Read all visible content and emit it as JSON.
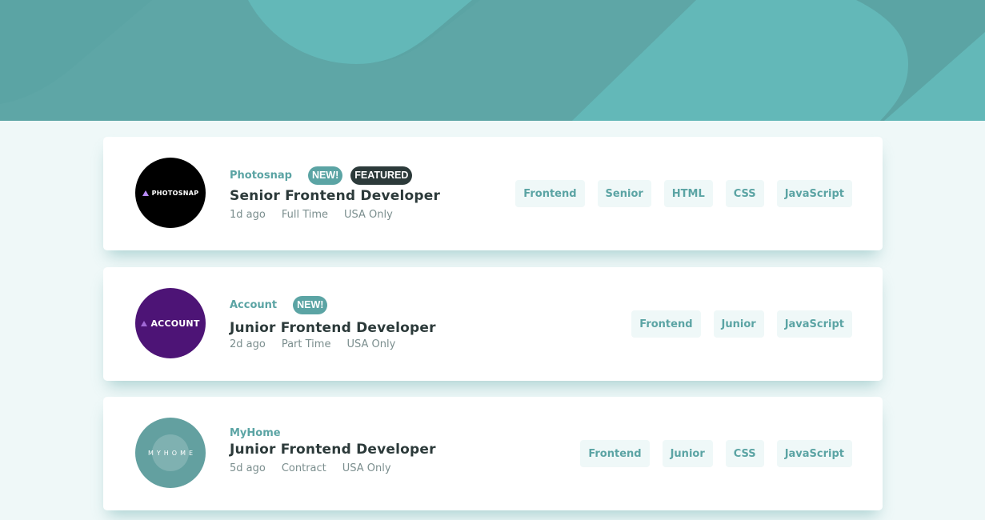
{
  "colors": {
    "primary": "#5ba4a4",
    "background": "#eff8f8",
    "dark": "#2c3a3a",
    "gray": "#7b8e8e",
    "photosnap_logo": "#000000",
    "account_logo": "#4d1476",
    "myhome_logo": "#63a0a0"
  },
  "jobs": [
    {
      "logo_text": "PHOTOSNAP",
      "company": "Photosnap",
      "new_label": "NEW!",
      "featured_label": "FEATURED",
      "position": "Senior Frontend Developer",
      "posted": "1d ago",
      "contract": "Full Time",
      "location": "USA Only",
      "tags": [
        "Frontend",
        "Senior",
        "HTML",
        "CSS",
        "JavaScript"
      ]
    },
    {
      "logo_text": "ACCOUNT",
      "company": "Account",
      "new_label": "NEW!",
      "position": "Junior Frontend Developer",
      "posted": "2d ago",
      "contract": "Part Time",
      "location": "USA Only",
      "tags": [
        "Frontend",
        "Junior",
        "JavaScript"
      ]
    },
    {
      "logo_text": "MYHOME",
      "company": "MyHome",
      "position": "Junior Frontend Developer",
      "posted": "5d ago",
      "contract": "Contract",
      "location": "USA Only",
      "tags": [
        "Frontend",
        "Junior",
        "CSS",
        "JavaScript"
      ]
    }
  ]
}
